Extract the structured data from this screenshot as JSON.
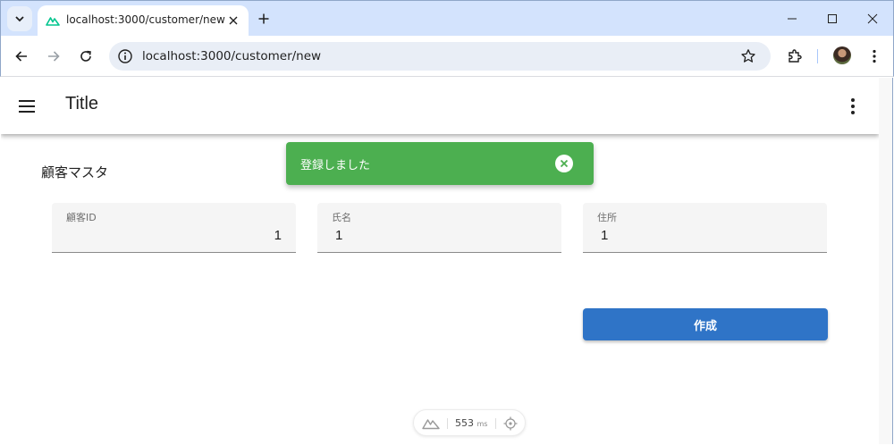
{
  "browser": {
    "tab_title": "localhost:3000/customer/new",
    "url": "localhost:3000/customer/new",
    "accent": "#d3e3fd"
  },
  "app": {
    "title": "Title",
    "section_title": "顧客マスタ"
  },
  "form": {
    "fields": [
      {
        "label": "顧客ID",
        "value": "1"
      },
      {
        "label": "氏名",
        "value": "1"
      },
      {
        "label": "住所",
        "value": "1"
      }
    ],
    "create_label": "作成",
    "create_color": "#2f74c7"
  },
  "snackbar": {
    "message": "登録しました",
    "color": "#4caf50"
  },
  "devtools": {
    "render_time": "553",
    "unit": "ms"
  }
}
